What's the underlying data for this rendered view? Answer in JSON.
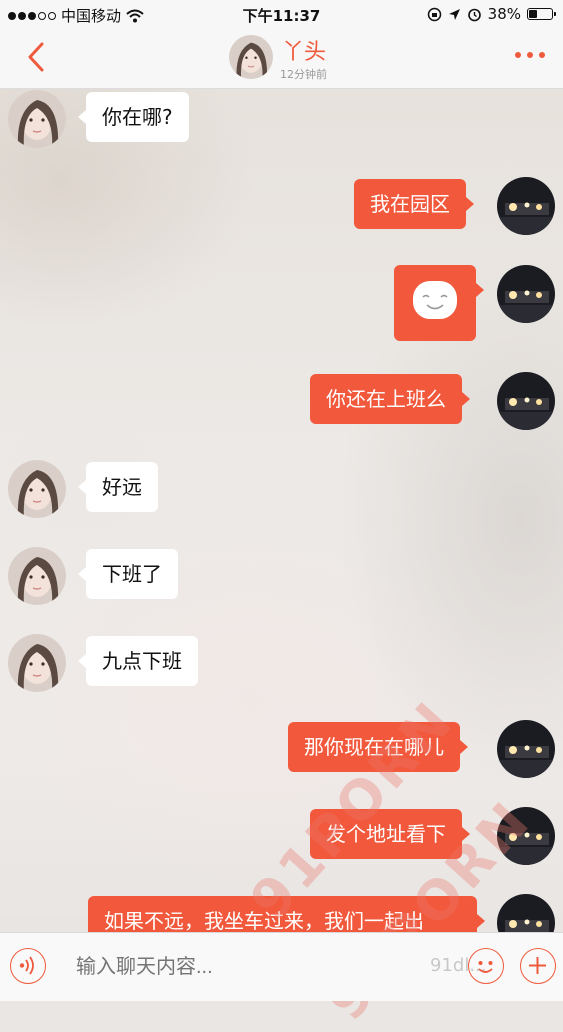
{
  "status_bar": {
    "carrier": "中国移动",
    "time": "下午11:37",
    "battery": "38%",
    "battery_level": 0.38
  },
  "header": {
    "title": "丫头",
    "subtitle": "12分钟前",
    "accent_color": "#ef5a3c"
  },
  "messages": [
    {
      "side": "in",
      "text": "你在哪?"
    },
    {
      "side": "out",
      "text": "我在园区"
    },
    {
      "side": "out",
      "text": "",
      "emoji": "smiling-face"
    },
    {
      "side": "out",
      "text": "你还在上班么"
    },
    {
      "side": "in",
      "text": "好远"
    },
    {
      "side": "in",
      "text": "下班了"
    },
    {
      "side": "in",
      "text": "九点下班"
    },
    {
      "side": "out",
      "text": "那你现在在哪儿"
    },
    {
      "side": "out",
      "text": "发个地址看下"
    },
    {
      "side": "out",
      "text": "如果不远，我坐车过来，我们一起出"
    }
  ],
  "input_bar": {
    "placeholder": "输入聊天内容..."
  },
  "watermarks": {
    "text1": "91PORN",
    "text2": "91PORN",
    "site": "91dl..."
  },
  "icons": {
    "back": "chevron-left-icon",
    "more": "more-dots-icon",
    "voice": "voice-icon",
    "emoji": "emoji-icon",
    "plus": "plus-icon"
  },
  "colors": {
    "outgoing_bubble": "#f2583b",
    "incoming_bubble": "#ffffff"
  }
}
